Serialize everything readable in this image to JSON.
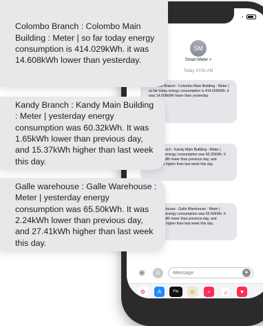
{
  "phone": {
    "contact_initials": "SM",
    "contact_name": "Smart-Meter >",
    "timestamp": "Today 10:51 AM",
    "back_glyph": "<",
    "input_placeholder": "iMessage",
    "messages": [
      {
        "text": "Colombo Branch : Colombo Main Building : Meter | so far today energy consumption is 414.029kWh. it was 14.608kWh lower than yesterday."
      },
      {
        "text": "Kandy Branch : Kandy Main Building : Meter | yesterday energy consumption was 60.32kWh. It was 1.65kWh lower than previous day, and 15.37kWh higher than last week this day."
      },
      {
        "text": "Galle warehouse : Galle Warehouse : Meter | yesterday energy consumption was 65.50kWh. It was 2.24kWh lower than previous day, and 27.41kWh higher than last week this day."
      }
    ],
    "tray_apps": [
      {
        "icon": "photos-app-icon",
        "glyph": "✿"
      },
      {
        "icon": "app-store-icon",
        "glyph": "A"
      },
      {
        "icon": "apple-pay-icon",
        "glyph": "Pay"
      },
      {
        "icon": "memoji-icon",
        "glyph": "☺"
      },
      {
        "icon": "search-images-icon",
        "glyph": "⌕"
      },
      {
        "icon": "music-icon",
        "glyph": "♫"
      },
      {
        "icon": "heart-icon",
        "glyph": "♥"
      }
    ]
  },
  "callouts": [
    {
      "text": "Colombo Branch : Colombo Main Building : Meter | so far today energy consumption is 414.029kWh. it was 14.608kWh lower than yesterday."
    },
    {
      "text": "Kandy Branch : Kandy Main Building : Meter | yesterday energy consumption was 60.32kWh. It was 1.65kWh lower than previous day, and 15.37kWh higher than last week this day."
    },
    {
      "text": "Galle warehouse : Galle Warehouse : Meter | yesterday energy consumption was 65.50kWh. It was 2.24kWh lower than previous day, and 27.41kWh higher than last week this day."
    }
  ],
  "colors": {
    "bubble_gray": "#e5e5ea",
    "callout_gray": "#e8e8ea",
    "phone_frame": "#2b2b2e",
    "ios_blue": "#0a84ff"
  }
}
